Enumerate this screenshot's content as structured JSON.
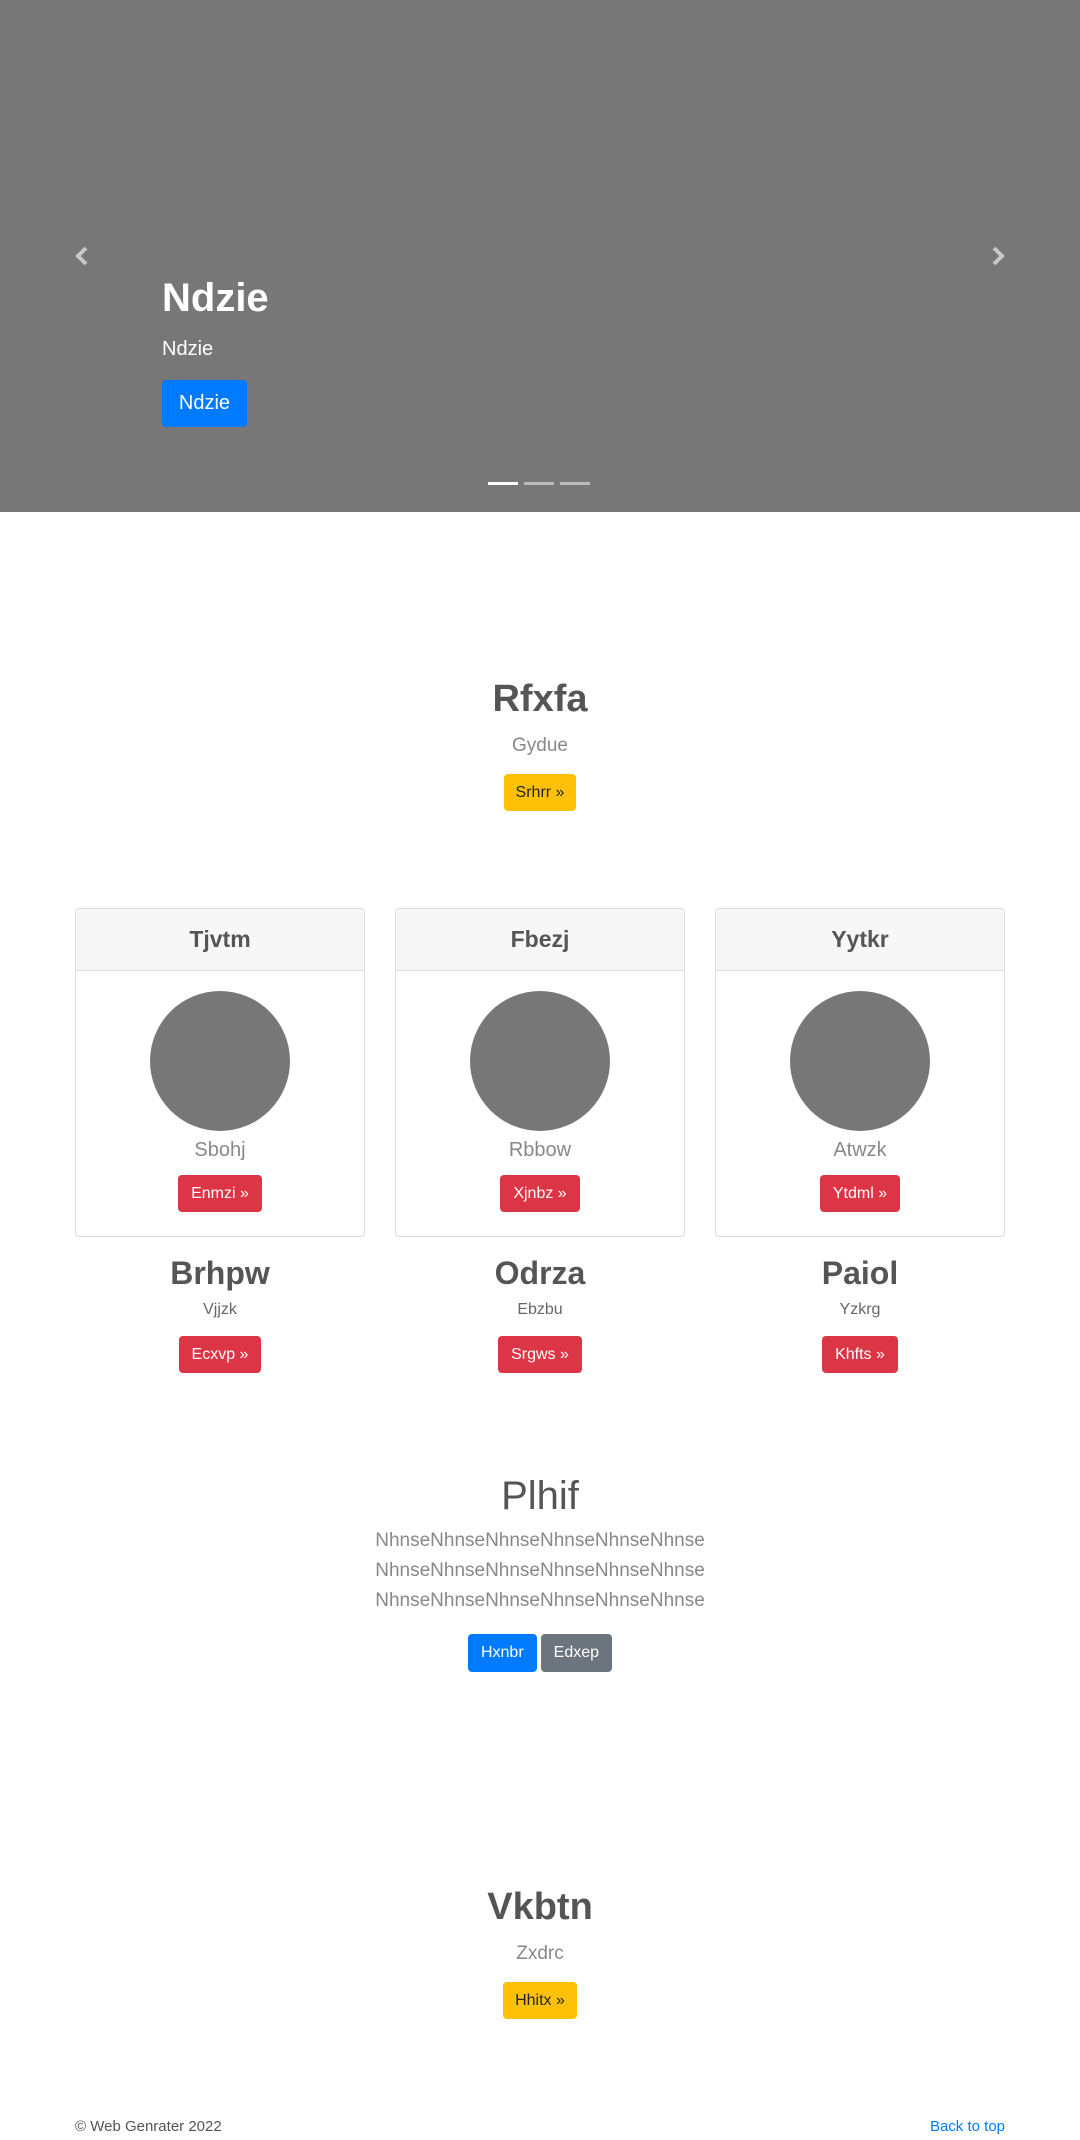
{
  "carousel": {
    "title": "Ndzie",
    "subtitle": "Ndzie",
    "button_label": "Ndzie",
    "indicator_count": 3,
    "active_indicator": 0
  },
  "section1": {
    "title": "Rfxfa",
    "subtitle": "Gydue",
    "button_label": "Srhrr »"
  },
  "cards": [
    {
      "header": "Tjvtm",
      "text": "Sbohj",
      "button_label": "Enmzi »"
    },
    {
      "header": "Fbezj",
      "text": "Rbbow",
      "button_label": "Xjnbz »"
    },
    {
      "header": "Yytkr",
      "text": "Atwzk",
      "button_label": "Ytdml »"
    }
  ],
  "columns": [
    {
      "title": "Brhpw",
      "subtitle": "Vjjzk",
      "button_label": "Ecxvp »"
    },
    {
      "title": "Odrza",
      "subtitle": "Ebzbu",
      "button_label": "Srgws »"
    },
    {
      "title": "Paiol",
      "subtitle": "Yzkrg",
      "button_label": "Khfts »"
    }
  ],
  "jumbotron": {
    "title": "Plhif",
    "lines": [
      "NhnseNhnseNhnseNhnseNhnseNhnse",
      "NhnseNhnseNhnseNhnseNhnseNhnse",
      "NhnseNhnseNhnseNhnseNhnseNhnse"
    ],
    "primary_label": "Hxnbr",
    "secondary_label": "Edxep"
  },
  "section2": {
    "title": "Vkbtn",
    "subtitle": "Zxdrc",
    "button_label": "Hhitx »"
  },
  "footer": {
    "copyright": "© Web Genrater 2022",
    "back_to_top": "Back to top"
  }
}
